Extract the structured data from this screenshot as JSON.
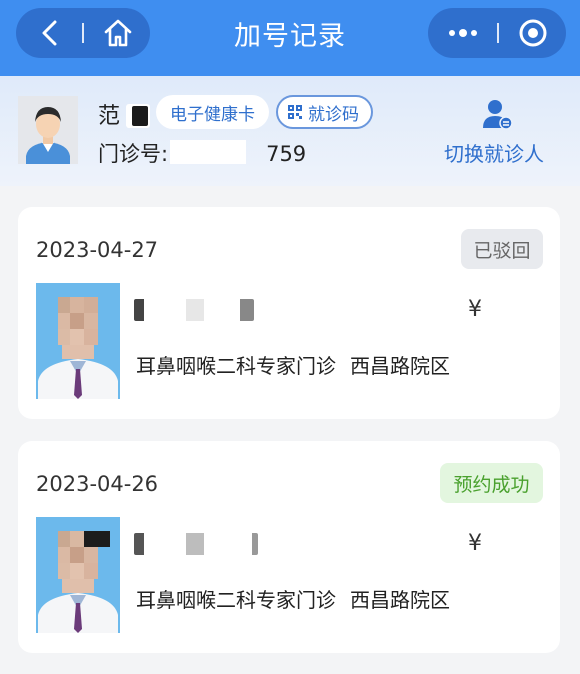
{
  "header": {
    "title": "加号记录",
    "back_icon": "chevron-left-icon",
    "home_icon": "home-icon",
    "more_icon": "more-dots-icon",
    "close_icon": "target-circle-icon",
    "bg_color": "#3f8ef0",
    "capsule_color": "#2f6fcd"
  },
  "patient": {
    "name": "范",
    "health_card_label": "电子健康卡",
    "visit_code_label": "就诊码",
    "clinic_number_label": "门诊号:",
    "clinic_number_suffix": "759",
    "switch_label": "切换就诊人",
    "switch_icon": "switch-user-icon"
  },
  "records": [
    {
      "date": "2023-04-27",
      "status": "已驳回",
      "status_color": "#666666",
      "price_symbol": "¥",
      "department": "耳鼻咽喉二科专家门诊",
      "campus": "西昌路院区"
    },
    {
      "date": "2023-04-26",
      "status": "预约成功",
      "status_color": "#4aa12e",
      "price_symbol": "¥",
      "department": "耳鼻咽喉二科专家门诊",
      "campus": "西昌路院区"
    }
  ]
}
